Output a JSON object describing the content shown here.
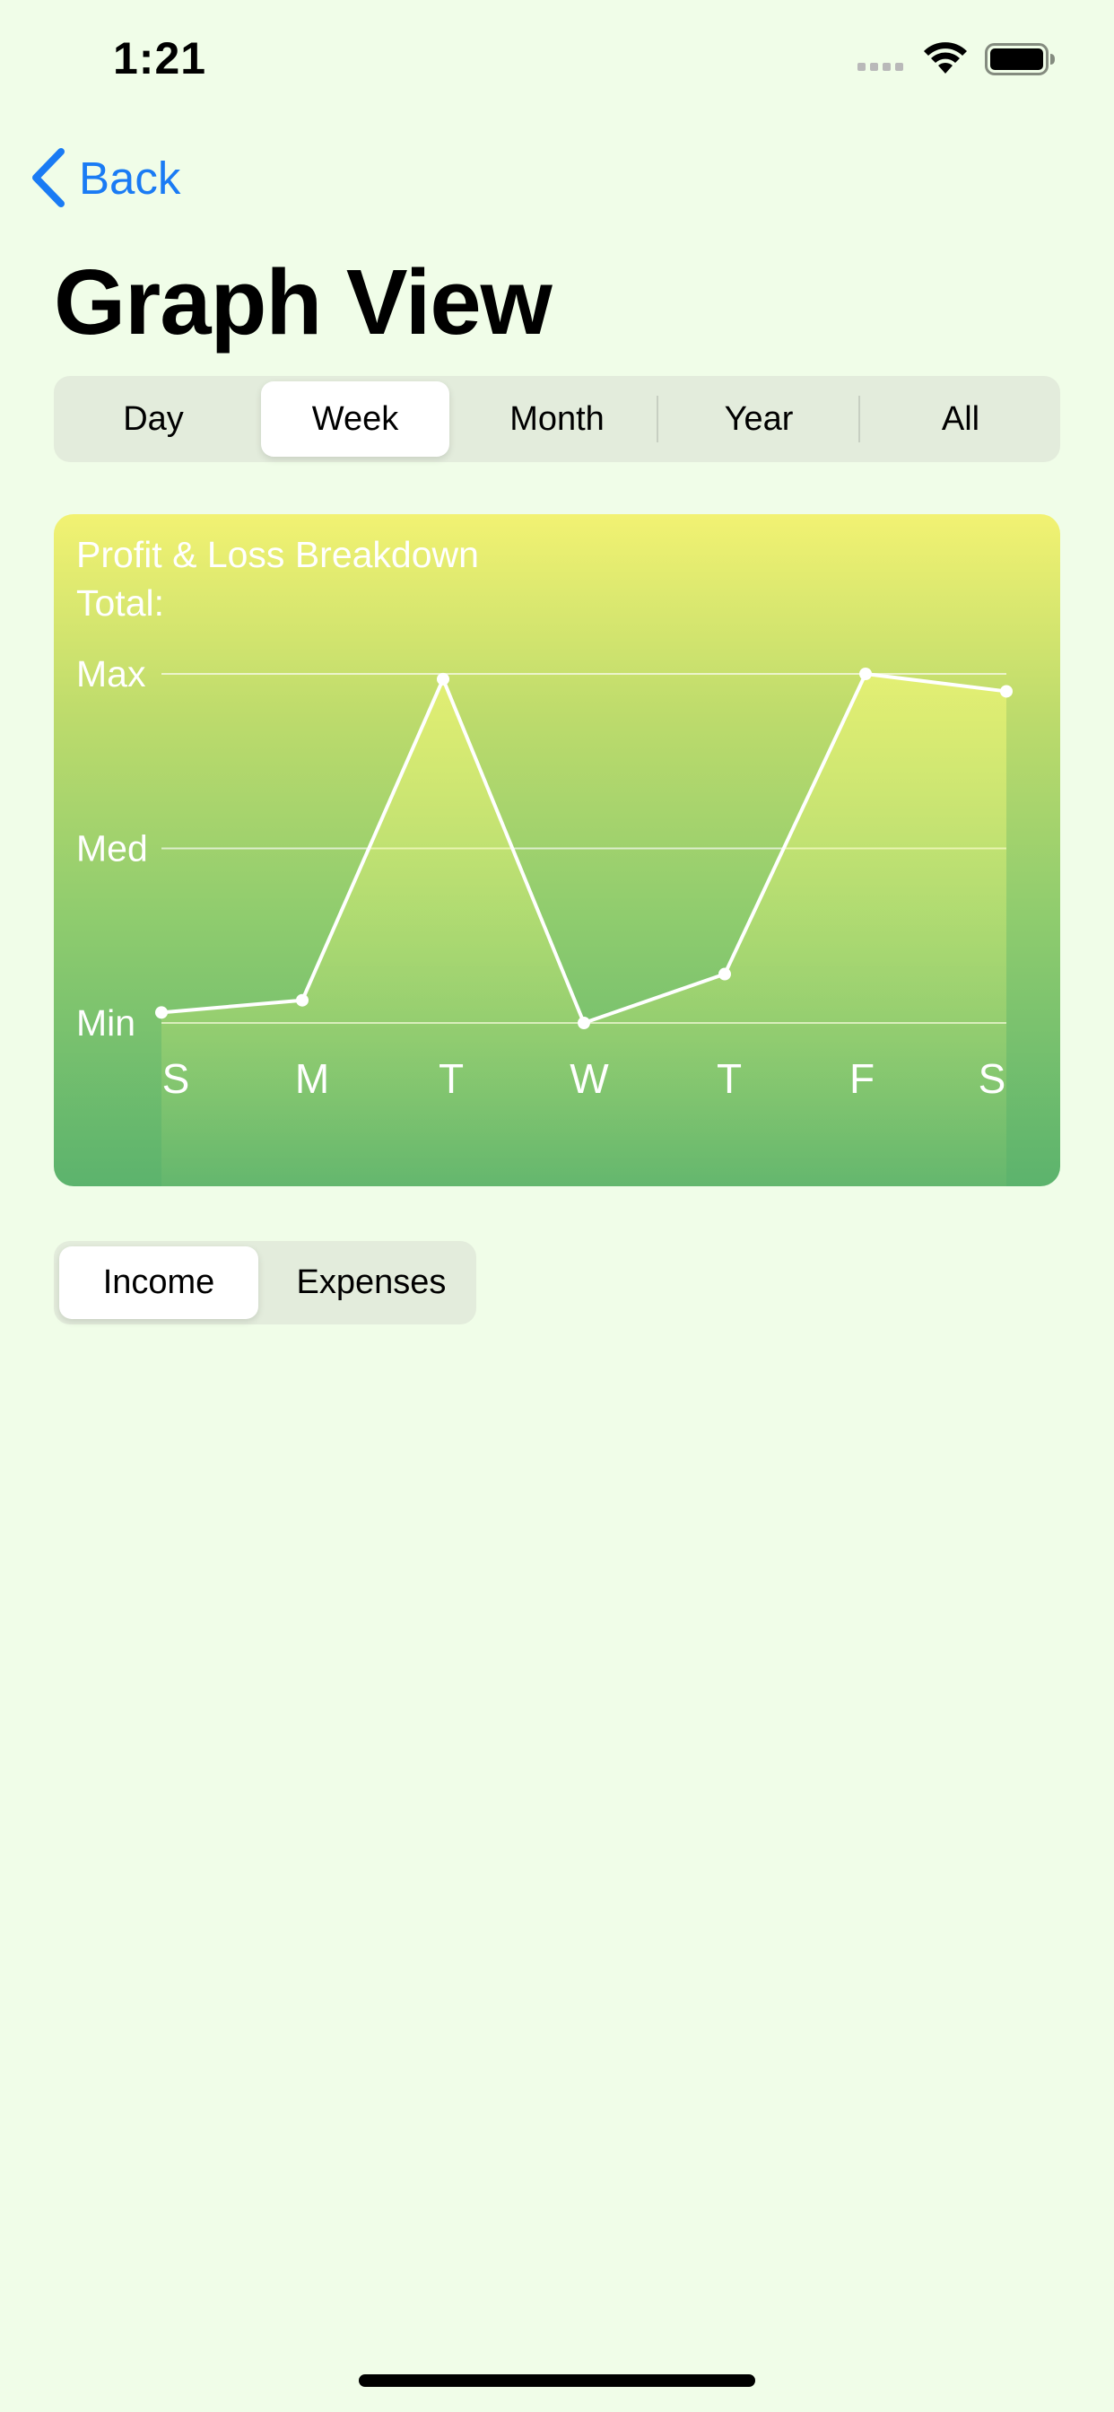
{
  "status_bar": {
    "time": "1:21",
    "icons": [
      "cellular-signal-icon",
      "wifi-icon",
      "battery-icon"
    ]
  },
  "nav": {
    "back_label": "Back",
    "back_icon": "chevron-left-icon",
    "accent_color": "#1a7bf4"
  },
  "page": {
    "title": "Graph View",
    "background_color": "#f0fde8"
  },
  "period_control": {
    "options": [
      "Day",
      "Week",
      "Month",
      "Year",
      "All"
    ],
    "selected": "Week"
  },
  "chart_card": {
    "title": "Profit & Loss Breakdown",
    "total_label": "Total:",
    "gradient_colors": [
      "#f2f272",
      "#5cb36d"
    ]
  },
  "chart_data": {
    "type": "line",
    "categories": [
      "S",
      "M",
      "T",
      "W",
      "T",
      "F",
      "S"
    ],
    "y_tick_labels": [
      "Max",
      "Med",
      "Min"
    ],
    "values_normalized": [
      0.03,
      0.065,
      0.985,
      0.0,
      0.14,
      1.0,
      0.95
    ],
    "line_color": "#ffffff",
    "grid": true,
    "legend": "none"
  },
  "type_control": {
    "options": [
      "Income",
      "Expenses"
    ],
    "selected": "Income"
  }
}
